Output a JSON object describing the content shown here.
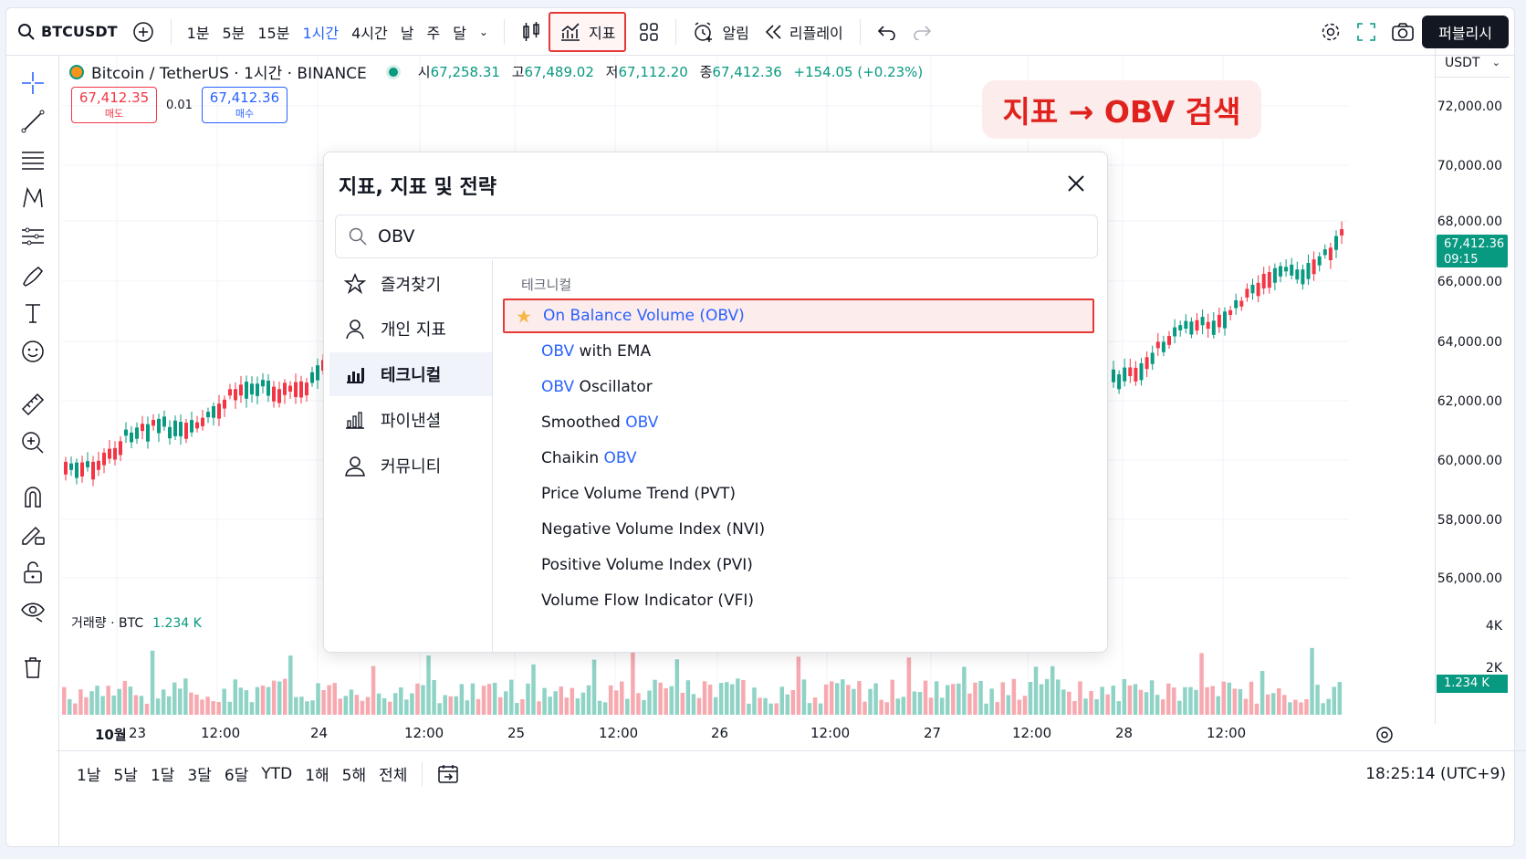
{
  "toolbar": {
    "symbol": "BTCUSDT",
    "timeframes": [
      "1분",
      "5분",
      "15분",
      "1시간",
      "4시간",
      "날",
      "주",
      "달"
    ],
    "indicators_label": "지표",
    "alerts_label": "알림",
    "replay_label": "리플레이",
    "publish_label": "퍼블리시"
  },
  "legend": {
    "name": "Bitcoin / TetherUS · 1시간 · BINANCE",
    "open_label": "시",
    "open": "67,258.31",
    "high_label": "고",
    "high": "67,489.02",
    "low_label": "저",
    "low": "67,112.20",
    "close_label": "종",
    "close": "67,412.36",
    "change": "+154.05 (+0.23%)"
  },
  "trade": {
    "sell_price": "67,412.35",
    "sell_label": "매도",
    "spread": "0.01",
    "buy_price": "67,412.36",
    "buy_label": "매수"
  },
  "callout": "지표 → OBV 검색",
  "dialog": {
    "title": "지표, 지표 및 전략",
    "search_value": "OBV",
    "nav": [
      "즐겨찾기",
      "개인 지표",
      "테크니컬",
      "파이낸셜",
      "커뮤니티"
    ],
    "category": "테크니컬",
    "items": [
      {
        "prefix": "",
        "match": "On Balance Volume (OBV)",
        "suffix": "",
        "highlighted": true
      },
      {
        "prefix": "",
        "match": "OBV",
        "suffix": " with EMA"
      },
      {
        "prefix": "",
        "match": "OBV",
        "suffix": " Oscillator"
      },
      {
        "prefix": "Smoothed ",
        "match": "OBV",
        "suffix": ""
      },
      {
        "prefix": "Chaikin ",
        "match": "OBV",
        "suffix": ""
      },
      {
        "prefix": "Price Volume Trend (PVT)",
        "match": "",
        "suffix": ""
      },
      {
        "prefix": "Negative Volume Index (NVI)",
        "match": "",
        "suffix": ""
      },
      {
        "prefix": "Positive Volume Index (PVI)",
        "match": "",
        "suffix": ""
      },
      {
        "prefix": "Volume Flow Indicator (VFI)",
        "match": "",
        "suffix": ""
      }
    ]
  },
  "price_axis": {
    "currency": "USDT",
    "labels": [
      "72,000.00",
      "70,000.00",
      "68,000.00",
      "66,000.00",
      "64,000.00",
      "62,000.00",
      "60,000.00",
      "58,000.00",
      "56,000.00"
    ],
    "last_price": "67,412.36",
    "countdown": "09:15",
    "vol_labels": [
      "4K",
      "2K"
    ],
    "vol_last": "1.234 K"
  },
  "volume": {
    "label": "거래량 · BTC",
    "value": "1.234 K"
  },
  "time_axis": {
    "labels": [
      "10월",
      "23",
      "12:00",
      "24",
      "12:00",
      "25",
      "12:00",
      "26",
      "12:00",
      "27",
      "12:00",
      "28",
      "12:00"
    ]
  },
  "bottom": {
    "ranges": [
      "1날",
      "5날",
      "1달",
      "3달",
      "6달",
      "YTD",
      "1해",
      "5해",
      "전체"
    ],
    "clock": "18:25:14 (UTC+9)"
  },
  "colors": {
    "up": "#089981",
    "down": "#f23645",
    "accent": "#2962ff",
    "highlight": "#e53935"
  }
}
